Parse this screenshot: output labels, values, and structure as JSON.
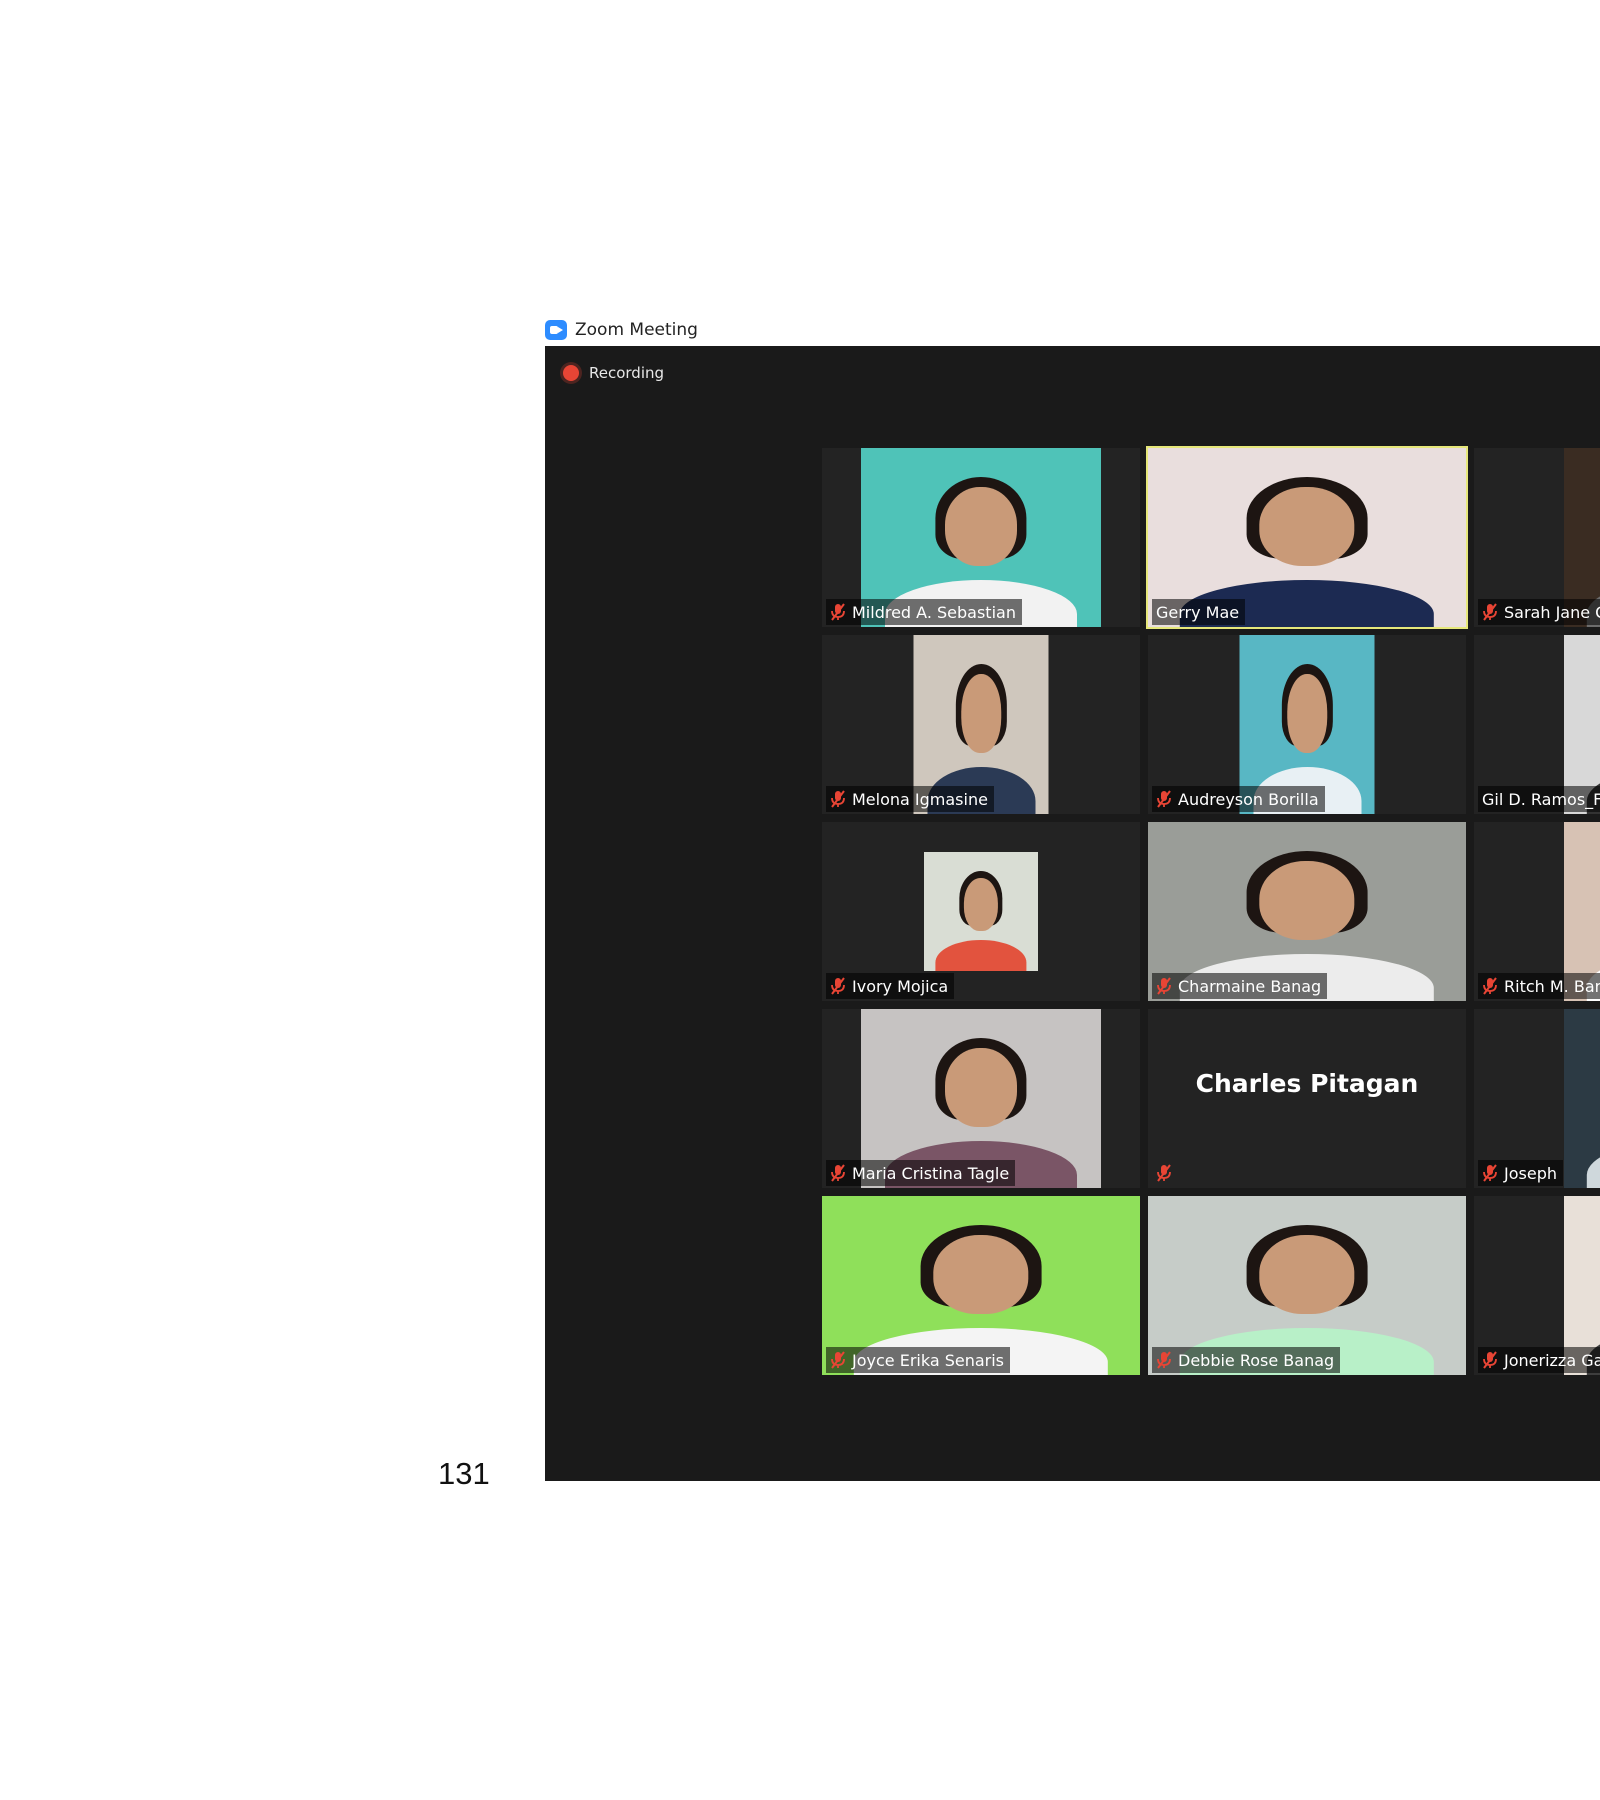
{
  "window": {
    "title": "Zoom Meeting",
    "recording_label": "Recording"
  },
  "participants": [
    {
      "name": "Mildred A. Sebastian",
      "muted": true,
      "video": true,
      "bg": "#4fc3b8",
      "shirt": "#f2f2f2"
    },
    {
      "name": "Gerry Mae",
      "muted": false,
      "video": true,
      "active_speaker": true,
      "bg": "#e9dedd",
      "shirt": "#1c2a52"
    },
    {
      "name": "Sarah Jane C",
      "muted": true,
      "video": true,
      "bg": "#3a2c22",
      "shirt": "#6d6d6d"
    },
    {
      "name": "Melona Igmasine",
      "muted": true,
      "video": true,
      "bg": "#cfc7bd",
      "shirt": "#2b3a55"
    },
    {
      "name": "Audreyson Borilla",
      "muted": true,
      "video": true,
      "bg": "#58b7c4",
      "shirt": "#e8f0f4"
    },
    {
      "name": "Gil D. Ramos_FA",
      "muted": false,
      "video": true,
      "bg": "#d8d8d8",
      "shirt": "#333333"
    },
    {
      "name": "Ivory Mojica",
      "muted": true,
      "video": true,
      "bg": "#d9ddd4",
      "shirt": "#e2533e"
    },
    {
      "name": "Charmaine Banag",
      "muted": true,
      "video": true,
      "bg": "#9a9d98",
      "shirt": "#ececec"
    },
    {
      "name": "Ritch M. Ban",
      "muted": true,
      "video": true,
      "bg": "#d7c2b4",
      "shirt": "#ffffff"
    },
    {
      "name": "Maria Cristina Tagle",
      "muted": true,
      "video": true,
      "bg": "#c6c3c2",
      "shirt": "#7a5566"
    },
    {
      "name": "Charles Pitagan",
      "muted": true,
      "video": false
    },
    {
      "name": "Joseph",
      "muted": true,
      "video": true,
      "bg": "#2c3a44",
      "shirt": "#cfd8dc"
    },
    {
      "name": "Joyce Erika Senaris",
      "muted": true,
      "video": true,
      "bg": "#8fe05a",
      "shirt": "#f4f4f4"
    },
    {
      "name": "Debbie Rose Banag",
      "muted": true,
      "video": true,
      "bg": "#c6ccc8",
      "shirt": "#b8f0c8"
    },
    {
      "name": "Jonerizza Ga",
      "muted": true,
      "video": true,
      "bg": "#e8e0d8",
      "shirt": "#3e3e3e"
    }
  ],
  "page": {
    "number": "131"
  },
  "colors": {
    "window_bg": "#1a1a1a",
    "tile_bg": "#232323",
    "active_border": "#e6e77a",
    "recording_dot": "#e84535",
    "mic_off": "#e84535",
    "zoom_blue": "#2d8cff"
  }
}
